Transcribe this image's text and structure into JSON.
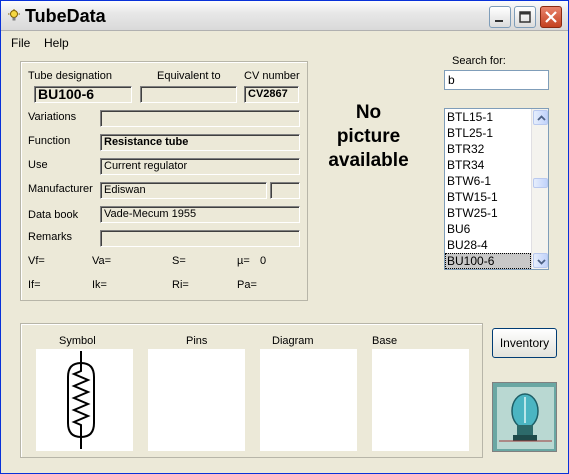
{
  "window": {
    "title": "TubeData",
    "icon": "lightbulb-icon"
  },
  "menu": {
    "file": "File",
    "help": "Help"
  },
  "fields": {
    "tube_designation_label": "Tube designation",
    "tube_designation": "BU100-6",
    "equivalent_label": "Equivalent to",
    "equivalent": "",
    "cv_label": "CV number",
    "cv": "CV2867",
    "variations_label": "Variations",
    "variations": "",
    "function_label": "Function",
    "function": "Resistance tube",
    "use_label": "Use",
    "use": "Current regulator",
    "manufacturer_label": "Manufacturer",
    "manufacturer": "Ediswan",
    "manufacturer_extra": "",
    "databook_label": "Data book",
    "databook": "Vade-Mecum 1955",
    "remarks_label": "Remarks",
    "remarks": ""
  },
  "params": {
    "vf": "Vf=",
    "va": "Va=",
    "s": "S=",
    "mu": "µ=",
    "mu_value": "0",
    "if": "If=",
    "ik": "Ik=",
    "ri": "Ri=",
    "pa": "Pa="
  },
  "no_picture": [
    "No",
    "picture",
    "available"
  ],
  "search": {
    "label": "Search for:",
    "value": "b"
  },
  "list": {
    "items": [
      "BTL15-1",
      "BTL25-1",
      "BTR32",
      "BTR34",
      "BTW6-1",
      "BTW15-1",
      "BTW25-1",
      "BU6",
      "BU28-4",
      "BU100-6"
    ],
    "selected": "BU100-6"
  },
  "tabs": {
    "symbol": "Symbol",
    "pins": "Pins",
    "diagram": "Diagram",
    "base": "Base"
  },
  "buttons": {
    "inventory": "Inventory"
  },
  "colors": {
    "titlebar": "#dcdcdc",
    "window_bg": "#ece9d8",
    "close_button": "#c4411f",
    "logo_bg": "#3a7a7a"
  }
}
